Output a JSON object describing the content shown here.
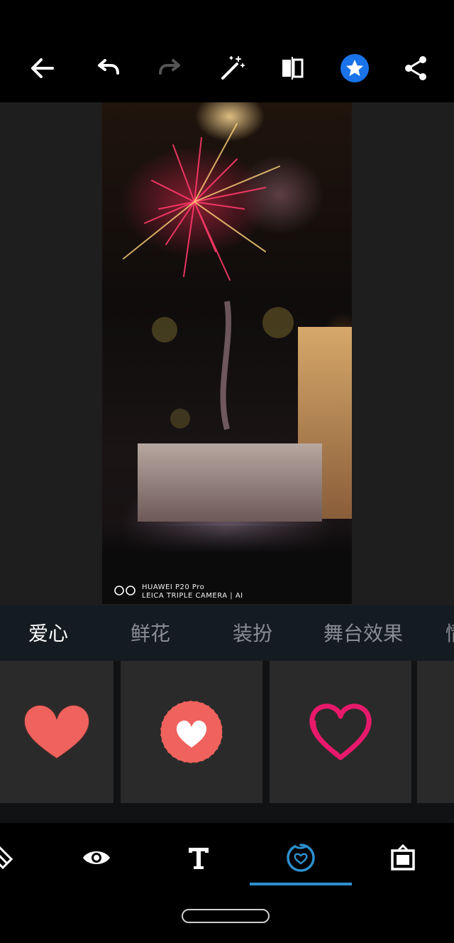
{
  "toolbar": {
    "buttons": [
      {
        "name": "back-arrow-icon"
      },
      {
        "name": "undo-icon"
      },
      {
        "name": "redo-icon",
        "enabled": false
      },
      {
        "name": "magic-wand-icon"
      },
      {
        "name": "compare-icon"
      },
      {
        "name": "star-badge-icon",
        "color": "#1a73e8"
      },
      {
        "name": "share-icon"
      }
    ]
  },
  "photo": {
    "watermark_line1": "HUAWEI P20 Pro",
    "watermark_line2": "LEICA TRIPLE CAMERA | AI"
  },
  "categories": {
    "items": [
      "爱心",
      "鲜花",
      "装扮",
      "舞台效果",
      "情"
    ],
    "active_index": 0
  },
  "stickers": [
    {
      "icon": "red-heart-sticker",
      "color": "#f0625d"
    },
    {
      "icon": "heart-in-circle-sticker",
      "color": "#f0625d"
    },
    {
      "icon": "pink-outline-heart-sticker",
      "color": "#e8196b"
    },
    {
      "icon": "sticker-partial"
    }
  ],
  "bottom_nav": {
    "items": [
      "eraser-icon",
      "eye-icon",
      "text-icon",
      "sticker-icon",
      "frame-icon"
    ],
    "active_index": 3,
    "accent": "#2e8fcf"
  }
}
